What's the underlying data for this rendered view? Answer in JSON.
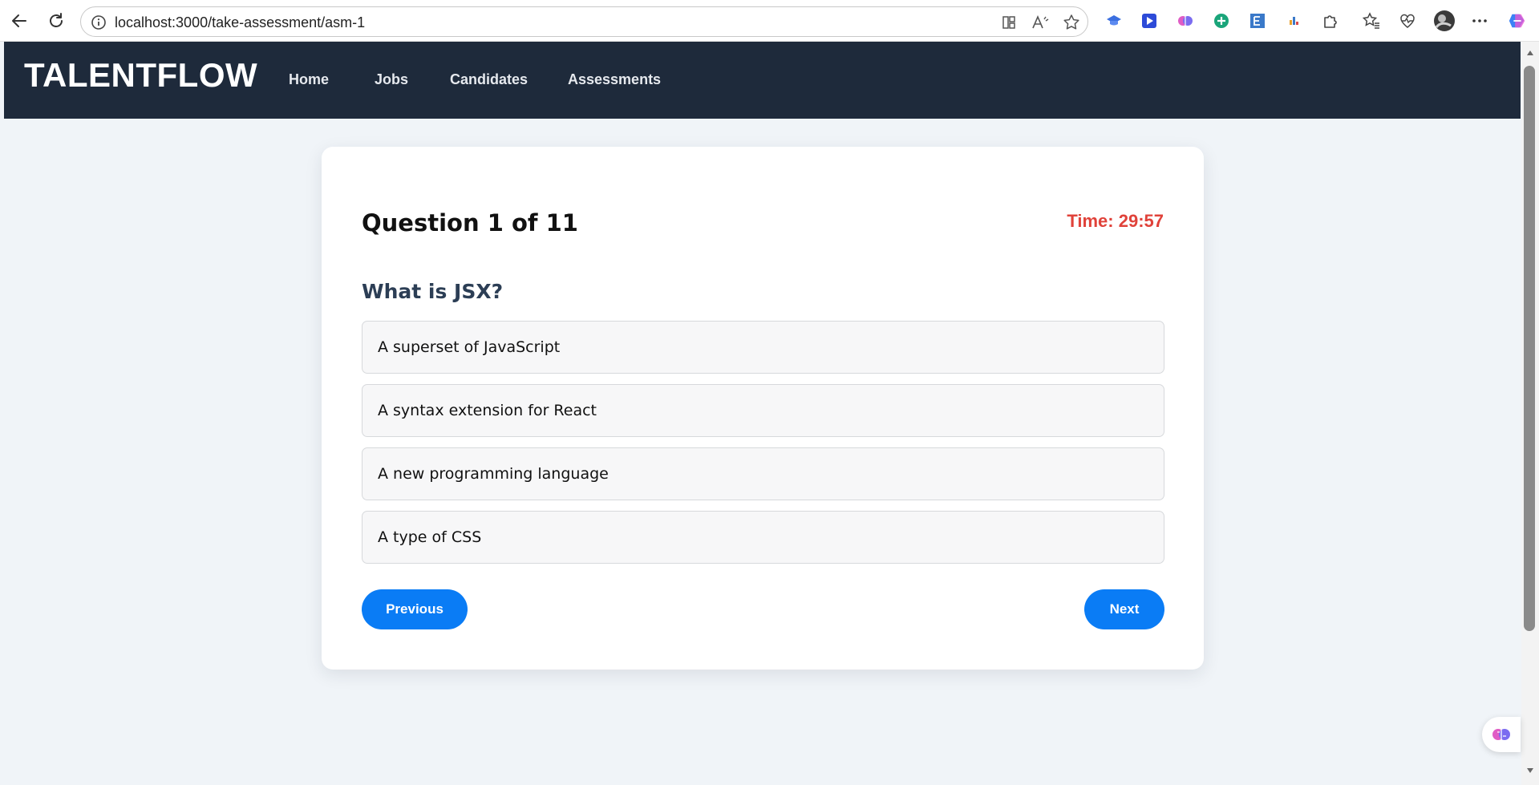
{
  "browser": {
    "url": "localhost:3000/take-assessment/asm-1"
  },
  "app": {
    "brand": "TALENTFLOW",
    "nav": [
      "Home",
      "Jobs",
      "Candidates",
      "Assessments"
    ]
  },
  "assessment": {
    "counter": "Question 1 of 11",
    "timer": "Time: 29:57",
    "question": "What is JSX?",
    "options": [
      "A superset of JavaScript",
      "A syntax extension for React",
      "A new programming language",
      "A type of CSS"
    ],
    "prev_label": "Previous",
    "next_label": "Next"
  },
  "colors": {
    "header_bg": "#1e2a3b",
    "accent": "#0a7cf5",
    "timer": "#e0423a"
  }
}
